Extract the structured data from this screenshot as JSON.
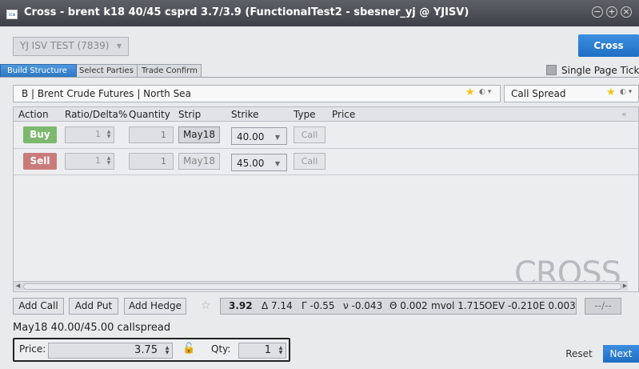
{
  "window": {
    "title": "Cross - brent k18 40/45 csprd 3.7/3.9 (FunctionalTest2 - sbesner_yj @ YJISV)",
    "app_icon": "ice"
  },
  "account": {
    "selected": "YJ ISV TEST (7839)"
  },
  "cross_label": "Cross",
  "tabs": [
    {
      "label": "Build Structure"
    },
    {
      "label": "Select Parties"
    },
    {
      "label": "Trade Confirm"
    }
  ],
  "single_page_ticket_label": "Single Page Ticket",
  "product": {
    "label": "B | Brent Crude Futures | North Sea"
  },
  "strategy": {
    "label": "Call Spread"
  },
  "grid": {
    "headers": {
      "action": "Action",
      "ratio": "Ratio/Delta%",
      "quantity": "Quantity",
      "strip": "Strip",
      "strike": "Strike",
      "type": "Type",
      "price": "Price"
    },
    "collapse_icon": "«",
    "legs": [
      {
        "action": "Buy",
        "ratio": "1",
        "quantity": "1",
        "strip": "May18",
        "strike": "40.00",
        "type": "Call"
      },
      {
        "action": "Sell",
        "ratio": "1",
        "quantity": "1",
        "strip": "May18",
        "strike": "45.00",
        "type": "Call"
      }
    ],
    "watermark": "CROSS"
  },
  "toolbar": {
    "add_call": "Add Call",
    "add_put": "Add Put",
    "add_hedge": "Add Hedge",
    "metrics": {
      "price": "3.92",
      "delta": "Δ 7.14",
      "gamma": "Γ -0.55",
      "vega": "ν -0.043",
      "theta": "Θ 0.002",
      "mvol": "mvol 1.715",
      "oev": "OEV -0.210",
      "e": "E 0.003"
    },
    "minmax": "--/--"
  },
  "summary": "May18 40.00/45.00 callspread",
  "order": {
    "price_label": "Price:",
    "price": "3.75",
    "qty_label": "Qty:",
    "qty": "1"
  },
  "buttons": {
    "reset": "Reset",
    "next": "Next"
  },
  "colors": {
    "buy": "#7cb86d",
    "sell": "#c97b7b",
    "accent": "#2a7fd4"
  }
}
